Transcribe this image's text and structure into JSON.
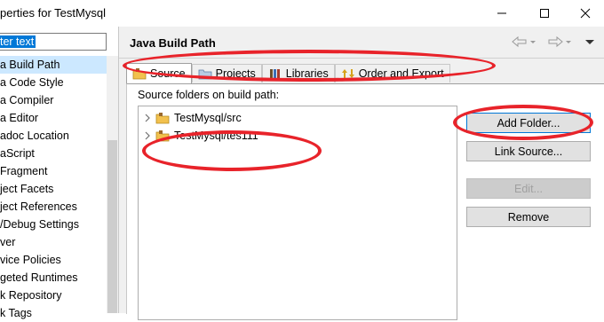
{
  "window": {
    "title": "perties for TestMysql"
  },
  "sidebar": {
    "filter_text": "ter text",
    "items": [
      {
        "label": "a Build Path",
        "selected": true
      },
      {
        "label": "a Code Style"
      },
      {
        "label": "a Compiler"
      },
      {
        "label": "a Editor"
      },
      {
        "label": "adoc Location"
      },
      {
        "label": "aScript"
      },
      {
        "label": " Fragment"
      },
      {
        "label": "ject Facets"
      },
      {
        "label": "ject References"
      },
      {
        "label": "/Debug Settings"
      },
      {
        "label": "ver"
      },
      {
        "label": "vice Policies"
      },
      {
        "label": "geted Runtimes"
      },
      {
        "label": "k Repository"
      },
      {
        "label": "k Tags"
      }
    ]
  },
  "page": {
    "title": "Java Build Path",
    "tabs": [
      {
        "label": "Source",
        "icon": "source-folder-icon",
        "active": true
      },
      {
        "label": "Projects",
        "icon": "projects-folder-icon"
      },
      {
        "label": "Libraries",
        "icon": "libraries-icon"
      },
      {
        "label": "Order and Export",
        "icon": "order-export-icon"
      }
    ],
    "source_label": "Source folders on build path:",
    "tree_items": [
      {
        "label": "TestMysql/src",
        "expandable": true
      },
      {
        "label": "TestMysql/tes111",
        "expandable": true
      }
    ],
    "buttons": {
      "add_folder": "Add Folder...",
      "link_source": "Link Source...",
      "edit": "Edit...",
      "remove": "Remove"
    }
  },
  "colors": {
    "annotation_red": "#e8232a",
    "selection_blue": "#0078d7",
    "panel_gray": "#f0f0f0"
  }
}
